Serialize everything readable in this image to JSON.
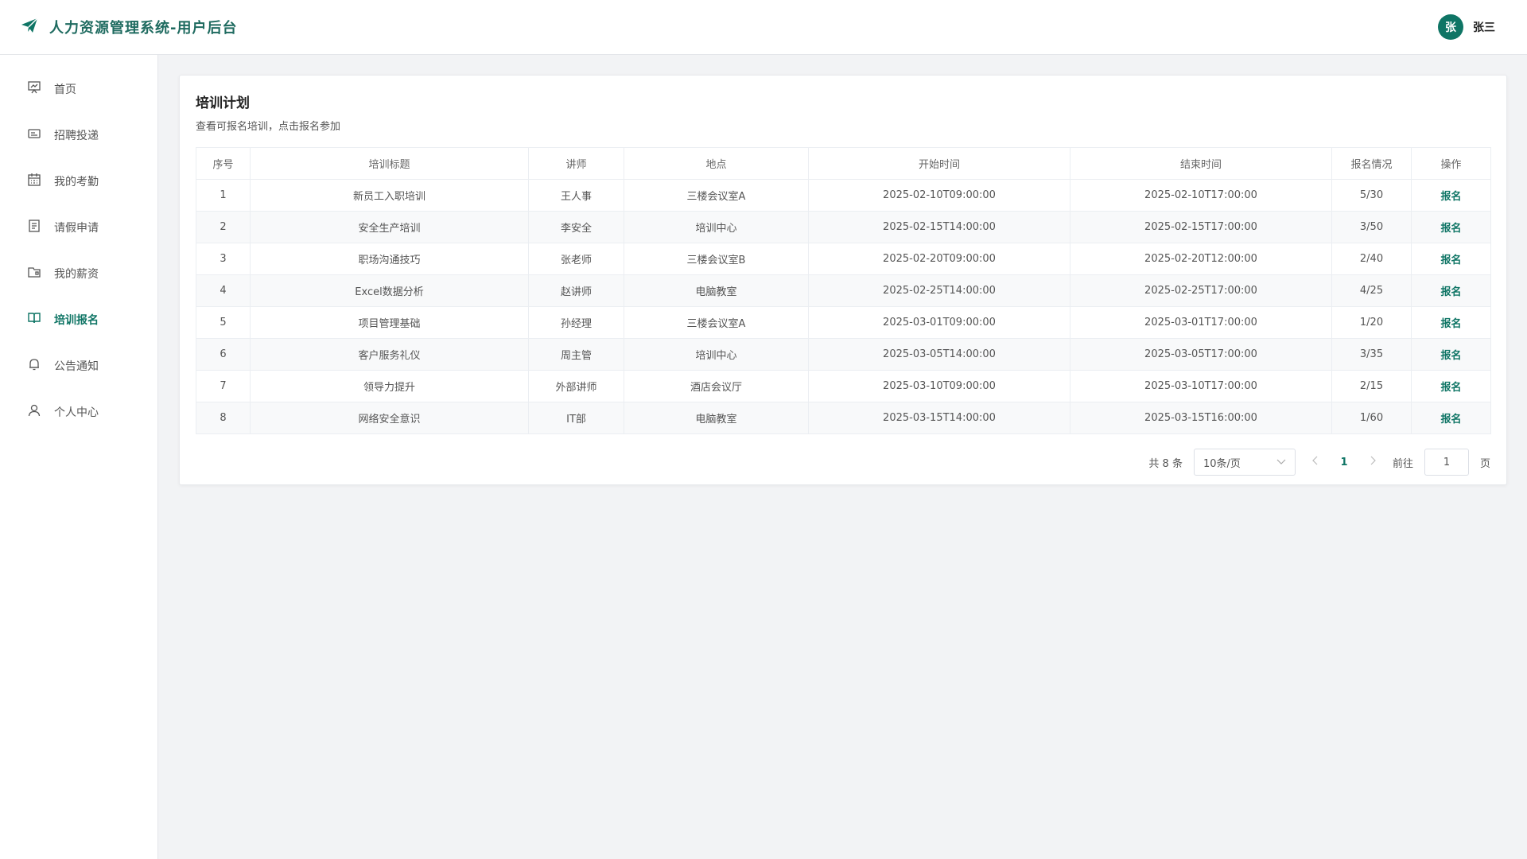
{
  "app": {
    "title": "人力资源管理系统-用户后台"
  },
  "user": {
    "avatar_text": "张",
    "name": "张三"
  },
  "sidebar": {
    "items": [
      {
        "label": "首页",
        "icon": "dashboard-icon",
        "active": false
      },
      {
        "label": "招聘投递",
        "icon": "recruit-icon",
        "active": false
      },
      {
        "label": "我的考勤",
        "icon": "calendar-icon",
        "active": false
      },
      {
        "label": "请假申请",
        "icon": "document-icon",
        "active": false
      },
      {
        "label": "我的薪资",
        "icon": "wallet-icon",
        "active": false
      },
      {
        "label": "培训报名",
        "icon": "book-icon",
        "active": true
      },
      {
        "label": "公告通知",
        "icon": "bell-icon",
        "active": false
      },
      {
        "label": "个人中心",
        "icon": "user-icon",
        "active": false
      }
    ]
  },
  "card": {
    "title": "培训计划",
    "subtitle": "查看可报名培训，点击报名参加"
  },
  "table": {
    "headers": [
      "序号",
      "培训标题",
      "讲师",
      "地点",
      "开始时间",
      "结束时间",
      "报名情况",
      "操作"
    ],
    "rows": [
      [
        "1",
        "新员工入职培训",
        "王人事",
        "三楼会议室A",
        "2025-02-10T09:00:00",
        "2025-02-10T17:00:00",
        "5/30",
        "报名"
      ],
      [
        "2",
        "安全生产培训",
        "李安全",
        "培训中心",
        "2025-02-15T14:00:00",
        "2025-02-15T17:00:00",
        "3/50",
        "报名"
      ],
      [
        "3",
        "职场沟通技巧",
        "张老师",
        "三楼会议室B",
        "2025-02-20T09:00:00",
        "2025-02-20T12:00:00",
        "2/40",
        "报名"
      ],
      [
        "4",
        "Excel数据分析",
        "赵讲师",
        "电脑教室",
        "2025-02-25T14:00:00",
        "2025-02-25T17:00:00",
        "4/25",
        "报名"
      ],
      [
        "5",
        "项目管理基础",
        "孙经理",
        "三楼会议室A",
        "2025-03-01T09:00:00",
        "2025-03-01T17:00:00",
        "1/20",
        "报名"
      ],
      [
        "6",
        "客户服务礼仪",
        "周主管",
        "培训中心",
        "2025-03-05T14:00:00",
        "2025-03-05T17:00:00",
        "3/35",
        "报名"
      ],
      [
        "7",
        "领导力提升",
        "外部讲师",
        "酒店会议厅",
        "2025-03-10T09:00:00",
        "2025-03-10T17:00:00",
        "2/15",
        "报名"
      ],
      [
        "8",
        "网络安全意识",
        "IT部",
        "电脑教室",
        "2025-03-15T14:00:00",
        "2025-03-15T16:00:00",
        "1/60",
        "报名"
      ]
    ]
  },
  "pagination": {
    "total_text": "共 8 条",
    "page_size": "10条/页",
    "current_page": "1",
    "goto_label": "前往",
    "goto_value": "1",
    "page_suffix": "页"
  },
  "colors": {
    "accent": "#0f7565"
  }
}
